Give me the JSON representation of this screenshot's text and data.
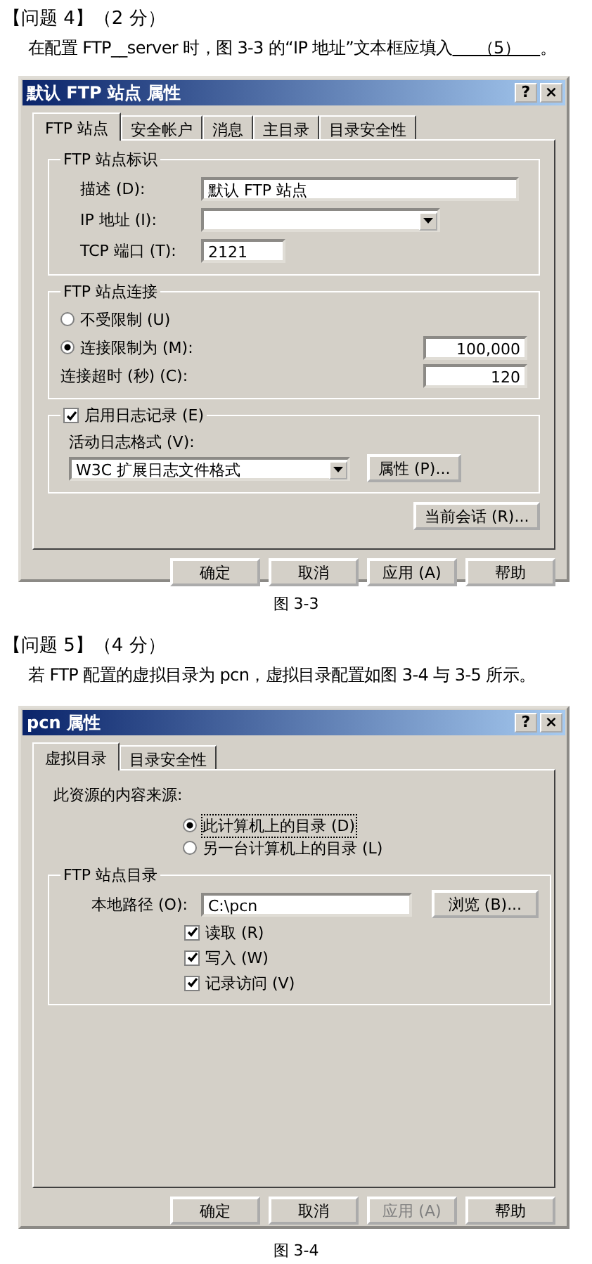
{
  "question_4": {
    "heading": "【问题 4】（2 分）",
    "text_before": "在配置 FTP__server 时，图 3-3 的“IP 地址”文本框应填入",
    "blank": "（5）",
    "text_after": "。"
  },
  "dialog_1": {
    "title": "默认 FTP 站点 属性",
    "title_buttons": [
      "?",
      "×"
    ],
    "tabs": [
      {
        "label": "FTP 站点",
        "selected": true
      },
      {
        "label": "安全帐户",
        "selected": false
      },
      {
        "label": "消息",
        "selected": false
      },
      {
        "label": "主目录",
        "selected": false
      },
      {
        "label": "目录安全性",
        "selected": false
      }
    ],
    "identification": {
      "legend": "FTP 站点标识",
      "fields": [
        {
          "label": "描述 (D):",
          "value": "默认 FTP 站点",
          "kind": "text"
        },
        {
          "label": "IP 地址 (I):",
          "kind": "combo"
        },
        {
          "label": "TCP 端口 (T):",
          "value": "2121",
          "kind": "short"
        }
      ]
    },
    "connection": {
      "legend": "FTP 站点连接",
      "options": [
        {
          "label": "不受限制 (U)",
          "selected": false
        },
        {
          "label": "连接限制为 (M):",
          "selected": true,
          "value": "100,000"
        }
      ],
      "timeout": {
        "label": "连接超时 (秒) (C):",
        "value": "120"
      }
    },
    "logging": {
      "legend": "启用日志记录 (E)",
      "checked": true,
      "format_label": "活动日志格式 (V):",
      "format": "W3C 扩展日志文件格式",
      "properties_button": "属性 (P)..."
    },
    "sessions_button": "当前会话 (R)...",
    "buttons": [
      {
        "label": "确定",
        "disabled": false
      },
      {
        "label": "取消",
        "disabled": false
      },
      {
        "label": "应用 (A)",
        "disabled": false
      },
      {
        "label": "帮助",
        "disabled": false
      }
    ]
  },
  "caption_1": "图 3-3",
  "question_5": {
    "heading": "【问题 5】（4 分）",
    "text": "若 FTP 配置的虚拟目录为 pcn，虚拟目录配置如图 3-4 与 3-5 所示。"
  },
  "dialog_2": {
    "title": "pcn 属性",
    "title_buttons": [
      "?",
      "×"
    ],
    "tabs": [
      {
        "label": "虚拟目录",
        "selected": true
      },
      {
        "label": "目录安全性",
        "selected": false
      }
    ],
    "source_label": "此资源的内容来源:",
    "sources": [
      {
        "label": "此计算机上的目录 (D)",
        "selected": true
      },
      {
        "label": "另一台计算机上的目录 (L)",
        "selected": false
      }
    ],
    "directory": {
      "legend": "FTP 站点目录",
      "path_label": "本地路径 (O):",
      "path": "C:\\pcn",
      "browse_button": "浏览 (B)...",
      "permissions": [
        {
          "label": "读取 (R)",
          "checked": true
        },
        {
          "label": "写入 (W)",
          "checked": true
        },
        {
          "label": "记录访问 (V)",
          "checked": true
        }
      ]
    },
    "buttons": [
      {
        "label": "确定",
        "disabled": false
      },
      {
        "label": "取消",
        "disabled": false
      },
      {
        "label": "应用 (A)",
        "disabled": true
      },
      {
        "label": "帮助",
        "disabled": false
      }
    ]
  },
  "caption_2": "图 3-4"
}
